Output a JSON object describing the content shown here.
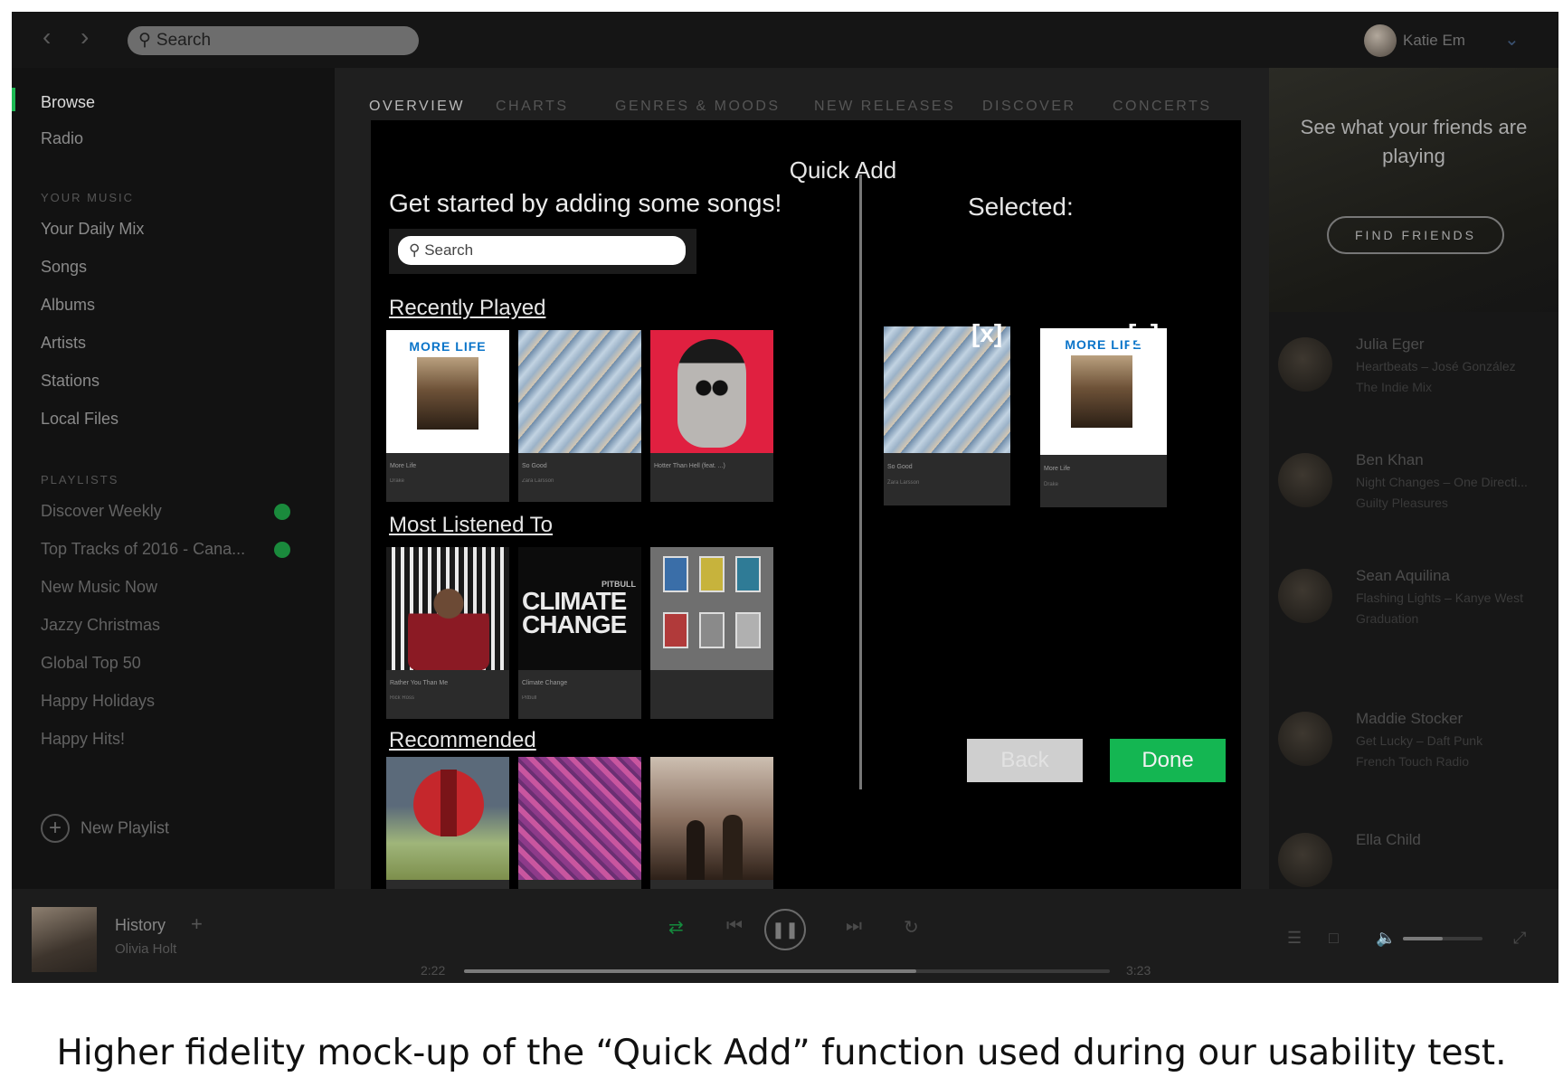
{
  "topbar": {
    "back_icon": "chevron-left-icon",
    "forward_icon": "chevron-right-icon",
    "search_placeholder": "Search",
    "user_name": "Katie Em"
  },
  "sidebar": {
    "main": [
      {
        "label": "Browse",
        "active": true
      },
      {
        "label": "Radio",
        "active": false
      }
    ],
    "your_music_heading": "YOUR MUSIC",
    "your_music": [
      "Your Daily Mix",
      "Songs",
      "Albums",
      "Artists",
      "Stations",
      "Local Files"
    ],
    "playlists_heading": "PLAYLISTS",
    "playlists": [
      {
        "label": "Discover Weekly",
        "downloaded": true
      },
      {
        "label": "Top Tracks of 2016 - Cana...",
        "downloaded": true
      },
      {
        "label": "New Music Now",
        "downloaded": false
      },
      {
        "label": "Jazzy Christmas",
        "downloaded": false
      },
      {
        "label": "Global Top 50",
        "downloaded": false
      },
      {
        "label": "Happy Holidays",
        "downloaded": false
      },
      {
        "label": "Happy Hits!",
        "downloaded": false
      }
    ],
    "new_playlist": "New Playlist"
  },
  "tabs": [
    "OVERVIEW",
    "CHARTS",
    "GENRES & MOODS",
    "NEW RELEASES",
    "DISCOVER",
    "CONCERTS"
  ],
  "active_tab": "OVERVIEW",
  "friends": {
    "title": "See what your friends are playing",
    "button": "FIND FRIENDS",
    "list": [
      {
        "name": "Julia Eger",
        "track": "Heartbeats – José González",
        "context": "The Indie Mix"
      },
      {
        "name": "Ben Khan",
        "track": "Night Changes – One Directi...",
        "context": "Guilty Pleasures"
      },
      {
        "name": "Sean Aquilina",
        "track": "Flashing Lights – Kanye West",
        "context": "Graduation"
      },
      {
        "name": "Maddie Stocker",
        "track": "Get Lucky – Daft Punk",
        "context": "French Touch Radio"
      },
      {
        "name": "Ella Child",
        "track": "",
        "context": ""
      }
    ]
  },
  "player": {
    "track": "History",
    "artist": "Olivia Holt",
    "elapsed": "2:22",
    "total": "3:23",
    "progress": 0.7,
    "volume": 0.5
  },
  "modal": {
    "title": "Quick Add",
    "subtitle": "Get started by adding some songs!",
    "search_placeholder": "Search",
    "sections": {
      "recently_played": "Recently Played",
      "most_listened": "Most Listened To",
      "recommended": "Recommended"
    },
    "recently_played": [
      {
        "title": "More Life",
        "subtitle": "Drake",
        "art": "morelife"
      },
      {
        "title": "So Good",
        "subtitle": "Zara Larsson",
        "art": "blue"
      },
      {
        "title": "Hotter Than Hell (feat. ...)",
        "subtitle": "",
        "art": "red"
      }
    ],
    "most_listened": [
      {
        "title": "Rather You Than Me",
        "subtitle": "Rick Ross",
        "art": "rr"
      },
      {
        "title": "Climate Change",
        "subtitle": "Pitbull",
        "art": "climate"
      },
      {
        "title": "",
        "subtitle": "",
        "art": "windows"
      }
    ],
    "recommended": [
      {
        "title": "",
        "subtitle": "",
        "art": "ear"
      },
      {
        "title": "",
        "subtitle": "",
        "art": "pink"
      },
      {
        "title": "",
        "subtitle": "",
        "art": "sunset"
      }
    ],
    "selected_label": "Selected:",
    "selected": [
      {
        "title": "So Good",
        "subtitle": "Zara Larsson",
        "art": "blue"
      },
      {
        "title": "More Life",
        "subtitle": "Drake",
        "art": "morelife"
      }
    ],
    "remove_label": "[x]",
    "back_button": "Back",
    "done_button": "Done"
  },
  "climate_art": {
    "line1": "CLIMATE",
    "line2": "CHANGE",
    "artist": "PITBULL"
  },
  "morelife_art": {
    "label": "MORE LIFE"
  },
  "caption": "Higher fidelity mock-up of the “Quick Add” function used during our usability test."
}
